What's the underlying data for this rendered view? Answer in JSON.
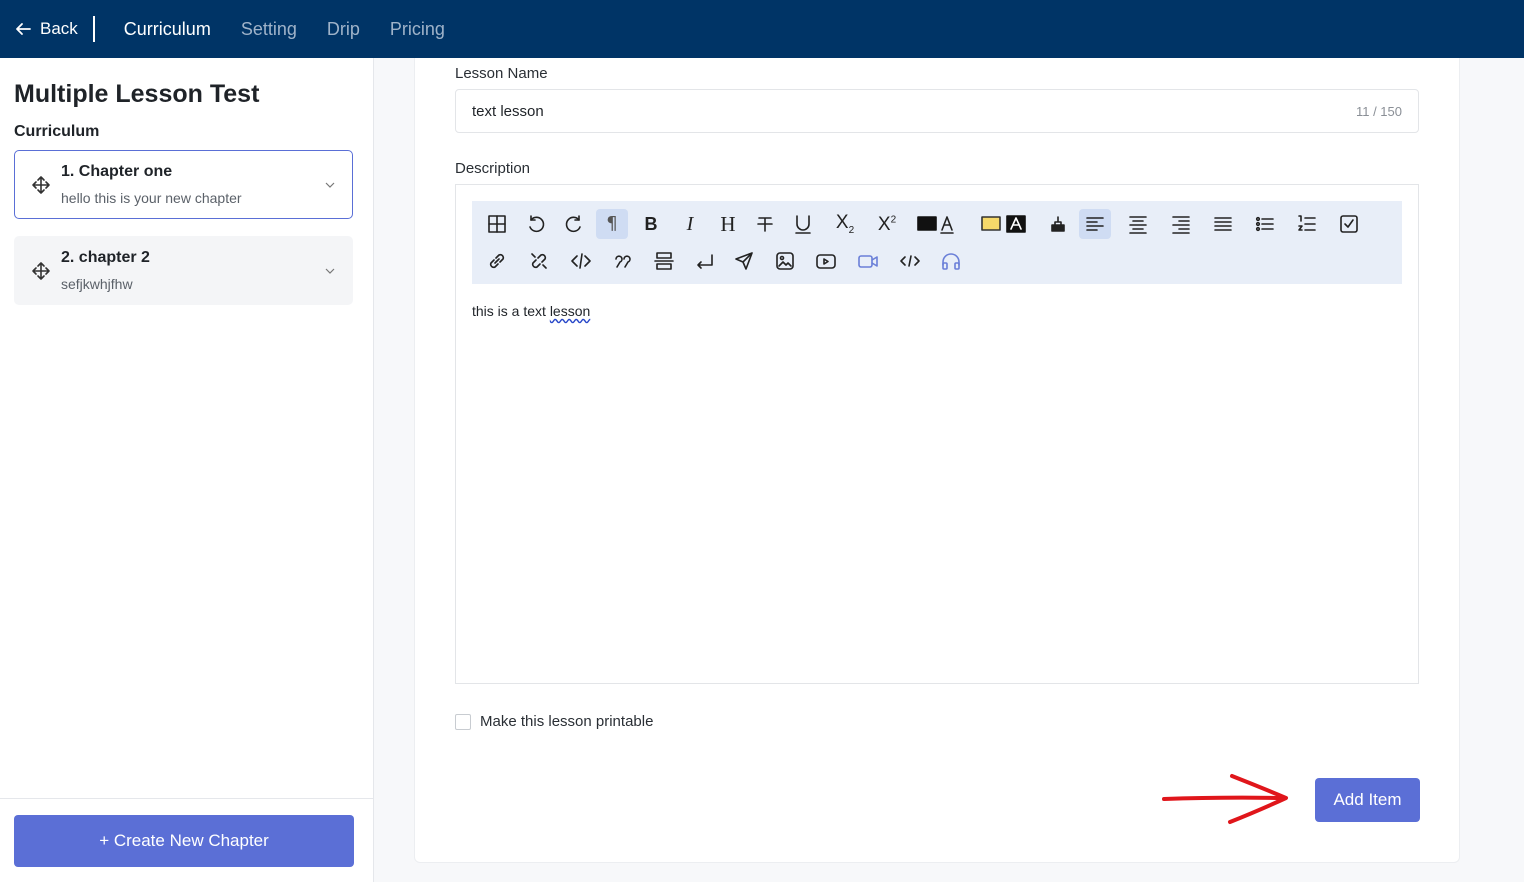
{
  "topnav": {
    "back_label": "Back",
    "tabs": [
      {
        "label": "Curriculum",
        "active": true
      },
      {
        "label": "Setting",
        "active": false
      },
      {
        "label": "Drip",
        "active": false
      },
      {
        "label": "Pricing",
        "active": false
      }
    ]
  },
  "sidebar": {
    "course_title": "Multiple Lesson Test",
    "section_label": "Curriculum",
    "chapters": [
      {
        "title": "1. Chapter one",
        "subtitle": "hello this is your new chapter",
        "selected": true
      },
      {
        "title": "2. chapter 2",
        "subtitle": "sefjkwhjfhw",
        "selected": false
      }
    ],
    "create_button": "+ Create New Chapter"
  },
  "form": {
    "lesson_name_label": "Lesson Name",
    "lesson_name_value": "text lesson",
    "lesson_name_counter": "11 / 150",
    "description_label": "Description",
    "description_text_plain": "this is a text ",
    "description_text_flagged": "lesson",
    "printable_label": "Make this lesson printable",
    "printable_checked": false,
    "add_button": "Add Item"
  },
  "toolbar_icons": [
    "table-icon",
    "undo-icon",
    "redo-icon",
    "paragraph-icon",
    "bold-icon",
    "italic-icon",
    "heading-icon",
    "strikethrough-icon",
    "underline-icon",
    "subscript-icon",
    "superscript-icon",
    "text-color-icon",
    "highlight-color-icon",
    "clear-format-icon",
    "align-left-icon",
    "align-center-icon",
    "align-right-icon",
    "align-justify-icon",
    "bullet-list-icon",
    "numbered-list-icon",
    "checklist-icon",
    "link-icon",
    "unlink-icon",
    "code-inline-icon",
    "blockquote-icon",
    "horizontal-rule-icon",
    "line-break-icon",
    "send-icon",
    "image-icon",
    "youtube-icon",
    "video-icon",
    "code-block-icon",
    "audio-icon"
  ],
  "colors": {
    "topbar": "#003466",
    "accent": "#5b6fd6",
    "toolbar_bg": "#e8eef8",
    "annotation_arrow": "#e0161b"
  }
}
